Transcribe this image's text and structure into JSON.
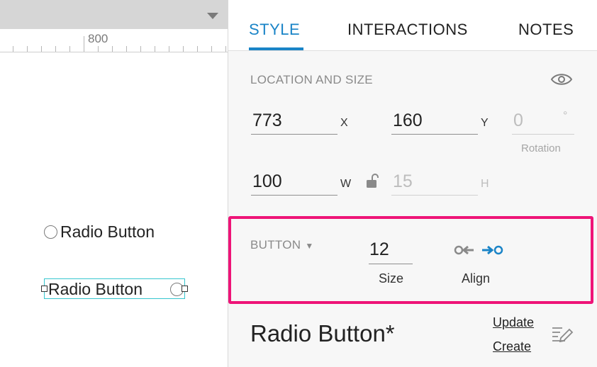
{
  "canvas": {
    "ruler_label": "800",
    "radio_unselected_label": "Radio Button",
    "radio_selected_label": "Radio Button"
  },
  "tabs": [
    {
      "label": "STYLE",
      "active": true
    },
    {
      "label": "INTERACTIONS",
      "active": false
    },
    {
      "label": "NOTES",
      "active": false
    }
  ],
  "location_size": {
    "title": "LOCATION AND SIZE",
    "x": {
      "value": "773",
      "unit": "X"
    },
    "y": {
      "value": "160",
      "unit": "Y"
    },
    "rotation": {
      "value": "0",
      "unit": "°",
      "caption": "Rotation"
    },
    "w": {
      "value": "100",
      "unit": "W"
    },
    "h": {
      "value": "15",
      "unit": "H"
    }
  },
  "button_style": {
    "dropdown_label": "BUTTON",
    "size_value": "12",
    "size_caption": "Size",
    "align_caption": "Align"
  },
  "style_name": {
    "title": "Radio Button*",
    "update_link": "Update",
    "create_link": "Create"
  },
  "colors": {
    "accent": "#1a84c7",
    "highlight": "#ee1478",
    "selection": "#36c6cf"
  },
  "icons": [
    "chevron-down-icon",
    "eye-icon",
    "lock-open-icon",
    "align-left-icon",
    "align-right-icon",
    "edit-style-icon"
  ]
}
